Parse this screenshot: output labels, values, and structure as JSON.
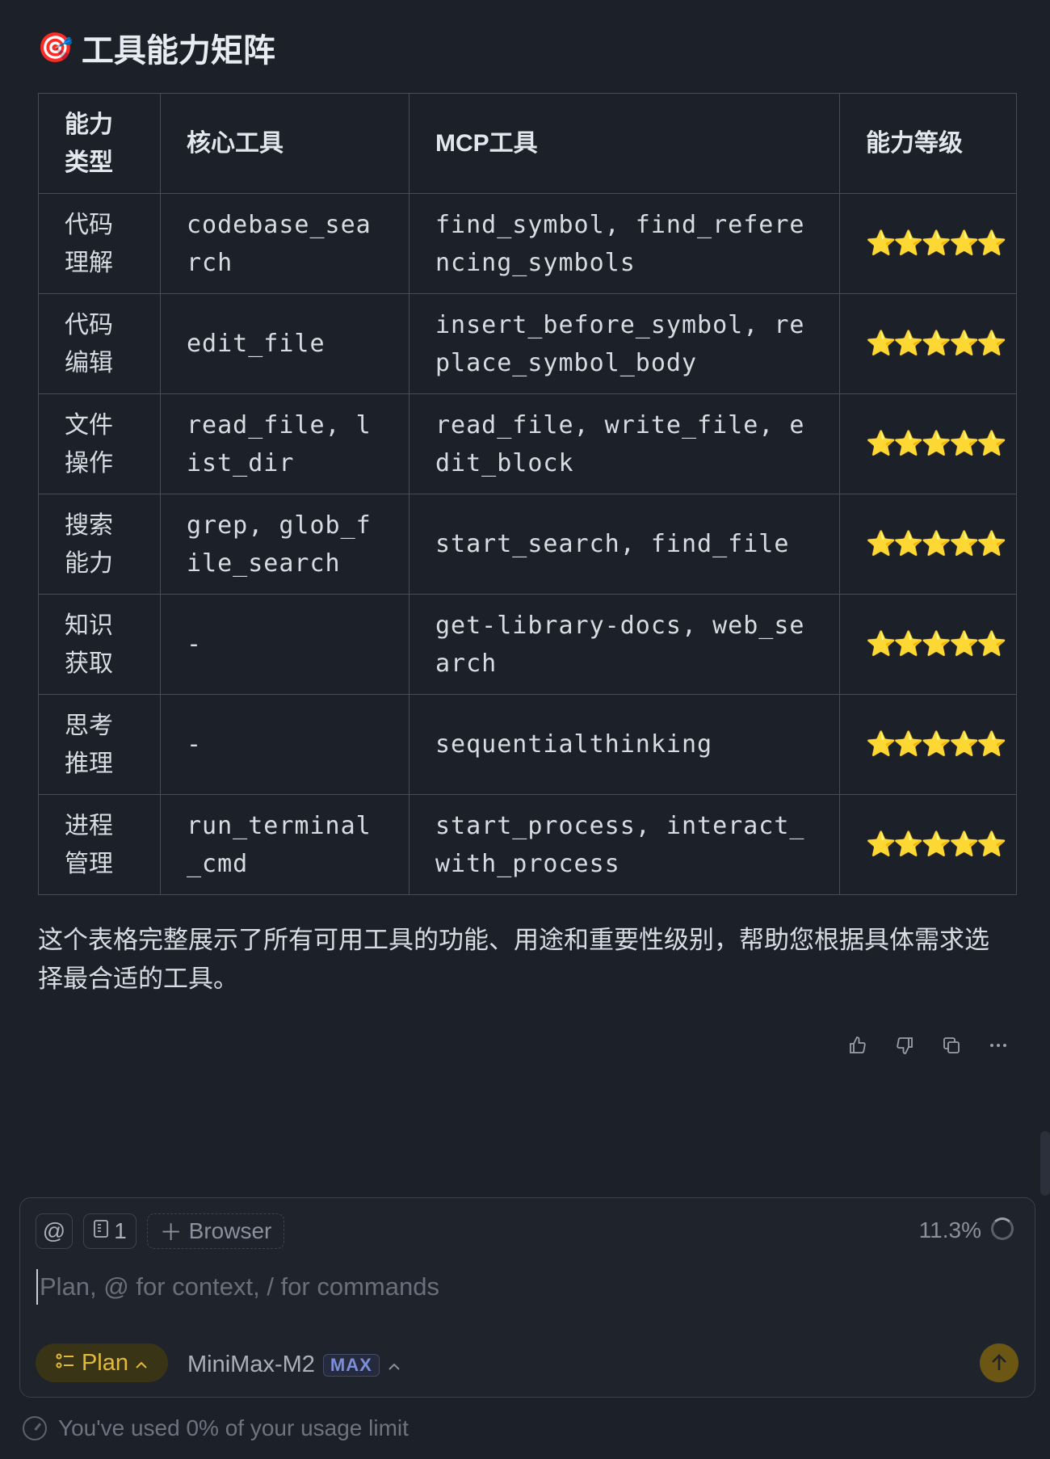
{
  "heading": {
    "emoji": "🎯",
    "title": "工具能力矩阵"
  },
  "table": {
    "headers": [
      "能力类型",
      "核心工具",
      "MCP工具",
      "能力等级"
    ],
    "rows": [
      {
        "category": "代码理解",
        "core": "codebase_search",
        "mcp": "find_symbol, find_referencing_symbols",
        "level": "⭐⭐⭐⭐⭐"
      },
      {
        "category": "代码编辑",
        "core": "edit_file",
        "mcp": "insert_before_symbol, replace_symbol_body",
        "level": "⭐⭐⭐⭐⭐"
      },
      {
        "category": "文件操作",
        "core": "read_file, list_dir",
        "mcp": "read_file, write_file, edit_block",
        "level": "⭐⭐⭐⭐⭐"
      },
      {
        "category": "搜索能力",
        "core": "grep, glob_file_search",
        "mcp": "start_search, find_file",
        "level": "⭐⭐⭐⭐⭐"
      },
      {
        "category": "知识获取",
        "core": "-",
        "mcp": "get-library-docs, web_search",
        "level": "⭐⭐⭐⭐⭐"
      },
      {
        "category": "思考推理",
        "core": "-",
        "mcp": "sequentialthinking",
        "level": "⭐⭐⭐⭐⭐"
      },
      {
        "category": "进程管理",
        "core": "run_terminal_cmd",
        "mcp": "start_process, interact_with_process",
        "level": "⭐⭐⭐⭐⭐"
      }
    ]
  },
  "summary": "这个表格完整展示了所有可用工具的功能、用途和重要性级别，帮助您根据具体需求选择最合适的工具。",
  "message_actions": [
    "thumbs-up-icon",
    "thumbs-down-icon",
    "copy-icon",
    "more-icon"
  ],
  "composer": {
    "at_label": "@",
    "files_count": "1",
    "browser_label": "Browser",
    "context_usage": "11.3%",
    "placeholder": "Plan, @ for context, / for commands",
    "mode_label": "Plan",
    "model_name": "MiniMax-M2",
    "model_badge": "MAX"
  },
  "footer": {
    "usage_text": "You've used 0% of your usage limit"
  },
  "colors": {
    "background": "#1c2029",
    "accent": "#e2b93b",
    "star": "#f5c531"
  }
}
